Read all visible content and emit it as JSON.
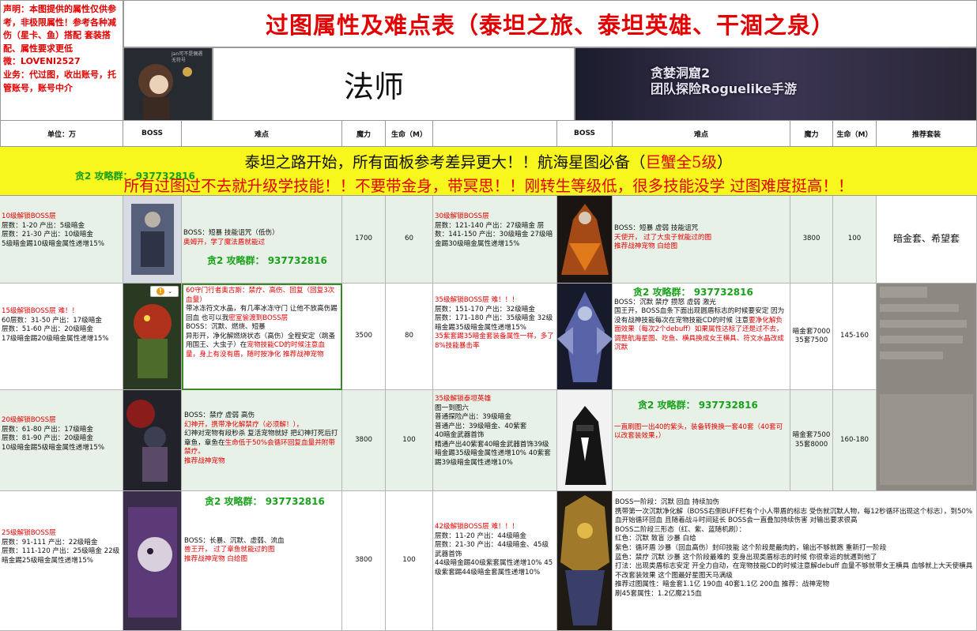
{
  "title": "过图属性及难点表（泰坦之旅、泰坦英雄、干涸之泉）",
  "disclaimer": "声明：本图提供的属性仅供参考，非极限属性！参考各种减伤（星卡、鱼）搭配 套装搭配、属性要求更低\n微：LOVENI2527\n业务：代过图，收出账号，托管账号，账号中介",
  "class_name": "法师",
  "banner_left_text": "Jan可不是偶遇\n无符号",
  "banner_right_text": "贪婪洞窟2\n团队探险Roguelike手游",
  "headers": {
    "unit": "单位：万",
    "boss": "BOSS",
    "difficulty": "难点",
    "magic": "魔力",
    "hp": "生命（M）",
    "boss2": "BOSS",
    "difficulty2": "难点",
    "magic2": "魔力",
    "hp2": "生命（M）",
    "recommend": "推荐套装"
  },
  "notice": {
    "line1_a": "泰坦之路开始，所有面板参考差异更大！！航海星图必备（",
    "line1_b": "巨蟹全5级",
    "line1_c": "）",
    "line2": "所有过图过不去就升级学技能！！不要带金身，带冥思！！刚转生等级低，很多技能没学 过图难度挺高！！",
    "watermark": "贪2 攻略群： 937732816"
  },
  "qq_group": "贪2 攻略群： 937732816",
  "rows": [
    {
      "left_info_title": "10级解锁BOSS层",
      "left_info": "层数：1-20  产出：5级暗金\n层数：21-30 产出：10级暗金\n5级暗金踢10级暗金属性递增15%",
      "left_diff_black": "BOSS：短暴  技能诅咒（低伤）",
      "left_diff_red": "奥姆开，学了魔法盾就能过",
      "left_magic": "1700",
      "left_hp": "60",
      "right_info_title": "30级解锁BOSS层",
      "right_info": "层数：121-140 产出：27级暗金    层数：141-150 产出：30级暗金   27级暗金踢30级暗金属性递增15%",
      "right_diff_black": "BOSS：短暴  虚弱  技能诅咒",
      "right_diff_red": "天使开，  过了大虫子就能过的图\n推荐战神宠物 白给图",
      "right_magic": "3800",
      "right_hp": "100",
      "recommend": "暗金套、希望套"
    },
    {
      "left_info_title": "15级解锁BOSS层      难！！",
      "left_info": "60层数：31-50 产出：17级暗金\n层数：51-60 产出：20级暗金\n17级暗金踢20级暗金属性递增15%",
      "left_diff_red1": "60守门行者奥古斯：禁疗、高伤、回复（回复3次血量）",
      "left_diff_black1": "带冰冻符文水晶，有几率冰冻守门 让他不放高伤踢回血 也可以我",
      "left_diff_red2": "密室偷渡到BOSS层",
      "left_diff_black2": "BOSS：沉默、燃烧、短暴\n异形开，净化解燃烧状态（高伤）全程安定（跳蚤用国王、大虫子）在",
      "left_diff_red3": "宠物技能CD的时候注意血量，身上有没有盾，随时按净化    推荐战神宠物",
      "left_magic": "3500",
      "left_hp": "80",
      "right_info_title": "35级解锁BOSS层         难！！！",
      "right_info": "层数：151-170 产出：32级暗金\n层数：171-180 产出：35级暗金   32级暗金踢35级暗金属性递增15%",
      "right_info_red": "35紫套踢35暗金套装备属性一样，多了8%技能暴击率",
      "right_diff_black": "BOSS：沉默 禁疗 攒怒 虚弱 激光\n国王开，BOSS血条下面出现圆盾标志的时候要安定    因为没有战神技能每次在宠物技能CD的时候  注意",
      "right_diff_red": "要净化解负面效果（每次2个debuff）如果属性达标了还是过不去，调整航海星图、吃鱼、横具换成女王横具、符文水晶改成沉默",
      "right_magic": "暗金套7000\n35套7500",
      "right_hp": "145-160"
    },
    {
      "left_info_title": "20级解锁BOSS层",
      "left_info": "层数：61-80 产出：17级暗金\n层数：81-90 产出：20级暗金\n10级暗金踢5级暗金属性递增15%",
      "left_diff_black1": "BOSS：禁疗  虚弱  高伤",
      "left_diff_red1": "幻神开，携带净化解禁疗（必须解！），",
      "left_diff_black2": "幻神对宠物有段秒杀  复活宠物就好  把幻神打死后打章鱼，章鱼在",
      "left_diff_red2": "生命低于50%会循环回复血量并附带禁疗。\n推荐战神宠物",
      "left_magic": "3800",
      "left_hp": "100",
      "right_info_title": "35级解锁泰坦英雄",
      "right_info": "图一到图六\n普通探险产出：39级暗金\n普通产出：39级暗金、40紫套\n40暗金武器首饰\n精通产出40紫套40暗金武器首饰39级暗金踢35级暗金属性递增10%  40紫套踢39级暗金属性递增10%",
      "right_diff_red": "一直刷图一出40的紫头，装备转换换一套40套（40套可以改套装效果，）",
      "right_magic": "暗金套7500\n35套8000",
      "right_hp": "160-180"
    },
    {
      "left_info_title": "25级解锁BOSS层",
      "left_info": "层数：91-111 产出：22级暗金\n层数：111-120 产出：25级暗金  22级暗金踢25级暗金属性递增15%",
      "left_diff_black": "BOSS：长暴、沉默、虚弱、流血",
      "left_diff_red": "兽王开，  过了章鱼就能过的图\n推荐战神宠物 白给图",
      "left_magic": "3800",
      "left_hp": "100",
      "right_info_title": "42级解锁BOSS层         难！！！",
      "right_info": "层数：11-20 产出：44级暗金\n层数：21-30 产出：44级暗金、45级武器首饰\n44级暗金踢40级紫套属性递增10% 45级紫套踢44级暗金套属性递增10%",
      "right_diff": "BOSS一阶段：沉默 回血 持续加伤\n携带第一次沉默净化解（BOSS右侧BUFF栏有个小人带盾的标志 受伤就沉默人物，每12秒循环出现这个标志），到50%血开始循环回血 且随着战斗时间延长 BOSS会一直叠加持续伤害 对输出要求很高\nBOSS二阶段三形态（红、紫、蓝随机刷）：\n红色：沉默 致盲 沙暴 白给\n紫色：循环盾 沙暴（回血高伤）封印技能 这个阶段是最肉的，输出不够就跑 重新打一阶段\n蓝色：禁疗 沉默 沙暴 这个阶段最难的 变身出现类盾标志的时候 你很幸运的就遇到他了\n打法：出现类盾标志安定  开全力自动，在宠物技能CD的时候注意解debuff   血量不够就带女王横具   血够就上大天使横具 不改套装效果 这个图最好星图天马满级\n推荐过图属性：暗金套1.1亿 190血 40套1.1亿 200血   推荐：战神宠物\n刷45套属性：1.2亿魔215血"
    }
  ]
}
